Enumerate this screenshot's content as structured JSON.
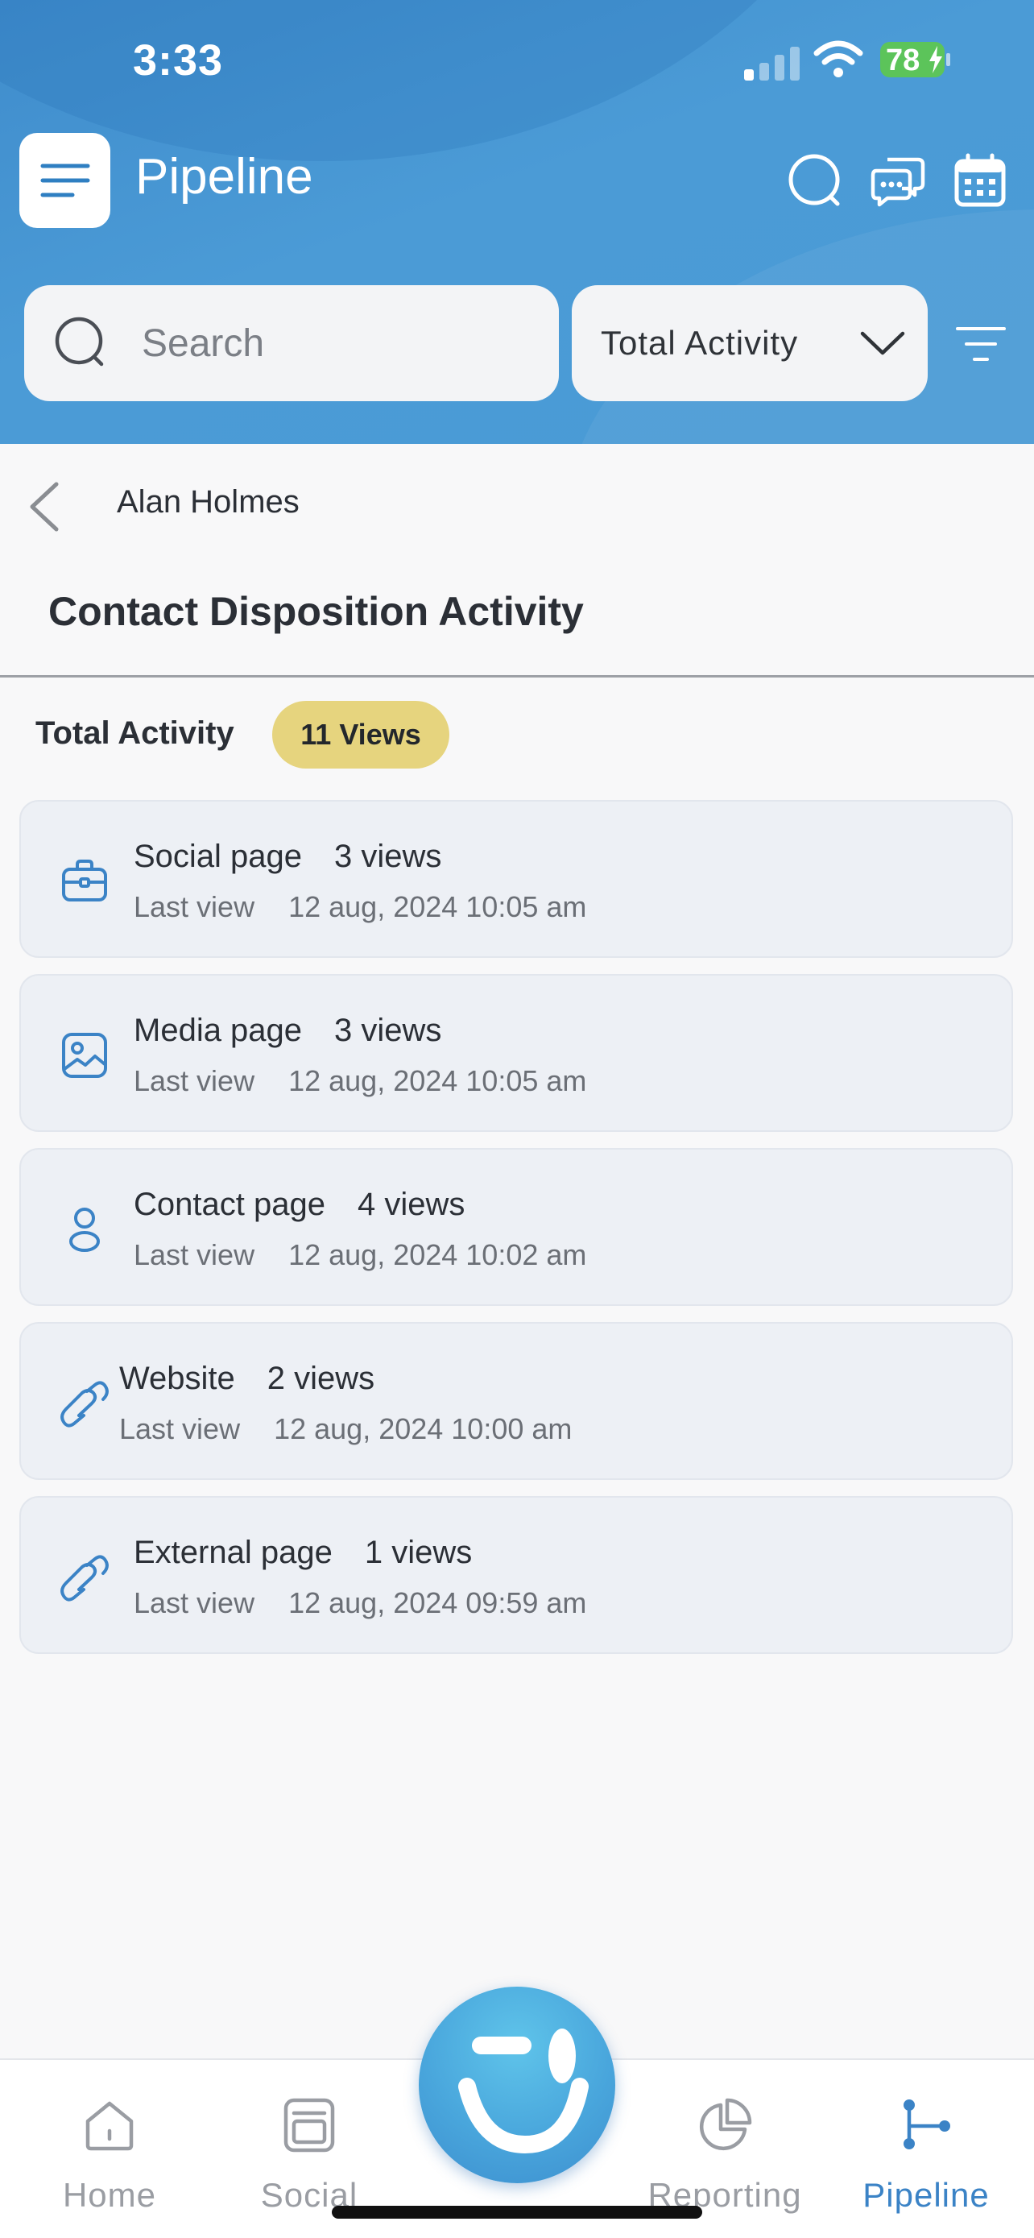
{
  "status_bar": {
    "time": "3:33",
    "battery": "78"
  },
  "header": {
    "title": "Pipeline"
  },
  "search": {
    "placeholder": "Search"
  },
  "filter_dropdown": {
    "selected": "Total Activity"
  },
  "contact": {
    "name": "Alan Holmes"
  },
  "section": {
    "title": "Contact Disposition Activity"
  },
  "summary": {
    "label": "Total Activity",
    "badge": "11 Views"
  },
  "activities": [
    {
      "page": "Social page",
      "views": "3 views",
      "last_label": "Last view",
      "date": "12 aug, 2024 10:05 am",
      "icon": "briefcase-icon"
    },
    {
      "page": "Media page",
      "views": "3 views",
      "last_label": "Last view",
      "date": "12 aug, 2024 10:05 am",
      "icon": "image-icon"
    },
    {
      "page": "Contact page",
      "views": "4 views",
      "last_label": "Last view",
      "date": "12 aug, 2024 10:02 am",
      "icon": "user-icon"
    },
    {
      "page": "Website",
      "views": "2 views",
      "last_label": "Last view",
      "date": "12 aug, 2024 10:00 am",
      "icon": "link-icon"
    },
    {
      "page": "External page",
      "views": "1 views",
      "last_label": "Last view",
      "date": "12 aug, 2024 09:59 am",
      "icon": "link-icon"
    }
  ],
  "bottom_nav": {
    "items": [
      {
        "label": "Home",
        "icon": "home-icon"
      },
      {
        "label": "Social",
        "icon": "social-icon"
      },
      {
        "label": "Reporting",
        "icon": "pie-chart-icon"
      },
      {
        "label": "Pipeline",
        "icon": "pipeline-icon"
      }
    ],
    "active": "Pipeline"
  },
  "colors": {
    "header": "#4a9bd5",
    "accent": "#3b83c6",
    "badge": "#e6d47e",
    "card": "#edf0f5"
  }
}
